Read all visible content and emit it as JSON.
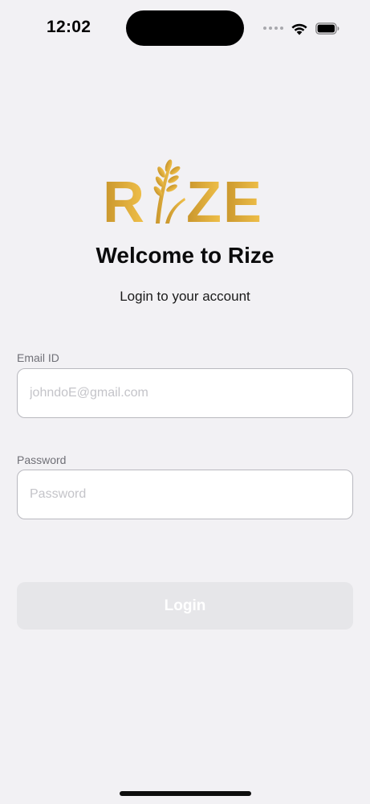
{
  "status_bar": {
    "time": "12:02",
    "icons": [
      "signal-dots-icon",
      "wifi-icon",
      "battery-icon"
    ]
  },
  "logo": {
    "text": "RIZE",
    "letters": [
      "R",
      "Z",
      "E"
    ],
    "icon": "wheat-icon",
    "gradient_colors": [
      "#c8952c",
      "#f0c04a"
    ]
  },
  "header": {
    "title": "Welcome to Rize",
    "subtitle": "Login to your account"
  },
  "form": {
    "email": {
      "label": "Email ID",
      "value": "",
      "placeholder": "johndoE@gmail.com"
    },
    "password": {
      "label": "Password",
      "value": "",
      "placeholder": "Password"
    },
    "login_label": "Login"
  },
  "colors": {
    "background": "#f2f1f4",
    "button_disabled": "#e6e6e9",
    "input_border": "#b9b9bf",
    "label": "#707077"
  }
}
